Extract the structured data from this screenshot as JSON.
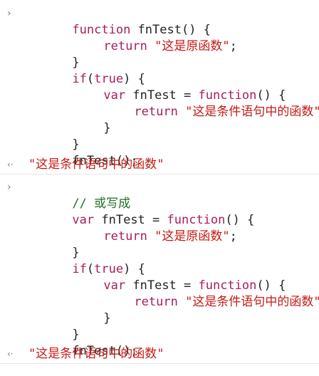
{
  "prompts": {
    "input": "›",
    "output": "‹·"
  },
  "entry1": {
    "l1": [
      "function",
      " fnTest() {"
    ],
    "l2": [
      "return",
      " ",
      "\"这是原函数\"",
      ";"
    ],
    "l3": "}",
    "l4": [
      "if",
      "(",
      "true",
      ") {"
    ],
    "l5": [
      "var",
      " fnTest = ",
      "function",
      "() {"
    ],
    "l6": [
      "return",
      " ",
      "\"这是条件语句中的函数\"",
      ";"
    ],
    "l7": "}",
    "l8": "}",
    "l9": "fnTest();",
    "result": "\"这是条件语句中的函数\""
  },
  "entry2": {
    "l1": "// 或写成",
    "l2": [
      "var",
      " fnTest = ",
      "function",
      "() {"
    ],
    "l3": [
      "return",
      " ",
      "\"这是原函数\"",
      ";"
    ],
    "l4": "}",
    "l5": [
      "if",
      "(",
      "true",
      ") {"
    ],
    "l6": [
      "var",
      " fnTest = ",
      "function",
      "() {"
    ],
    "l7": [
      "return",
      " ",
      "\"这是条件语句中的函数\"",
      ";"
    ],
    "l8": "}",
    "l9": "}",
    "l10": "fnTest();",
    "result": "\"这是条件语句中的函数\""
  }
}
